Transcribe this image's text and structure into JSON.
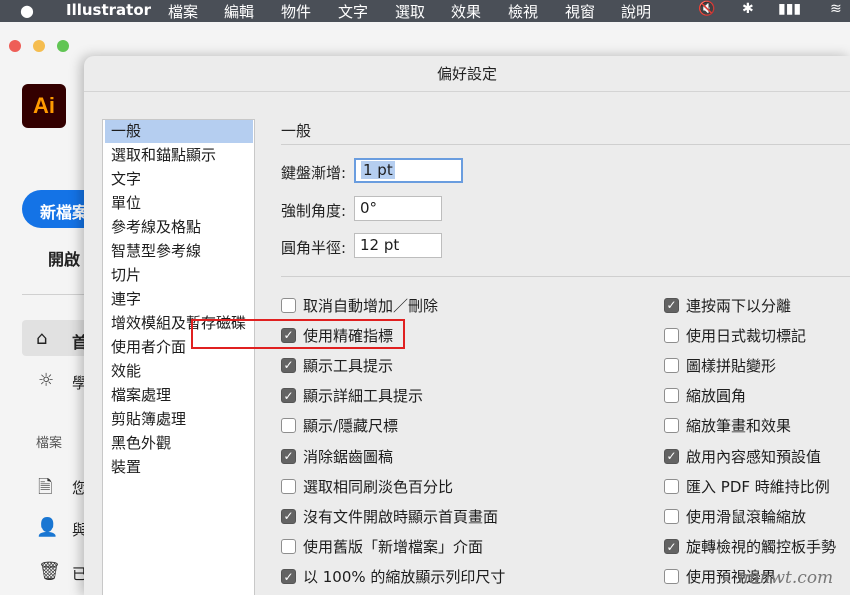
{
  "menubar": {
    "apple_icon": "",
    "app_name": "Illustrator",
    "items": [
      "檔案",
      "編輯",
      "物件",
      "文字",
      "選取",
      "效果",
      "檢視",
      "視窗",
      "說明"
    ],
    "status_icons": [
      "mute-icon",
      "bluetooth-icon",
      "battery-icon",
      "wifi-icon"
    ]
  },
  "background_app": {
    "logo_text": "Ai",
    "new_button": "新檔案",
    "open_button": "開啟",
    "nav_home": "首",
    "nav_learn": "學",
    "files_header": "檔案",
    "nav_files": "您",
    "nav_shared": "與",
    "nav_deleted": "已"
  },
  "dialog": {
    "title": "偏好設定",
    "categories": [
      "一般",
      "選取和錨點顯示",
      "文字",
      "單位",
      "參考線及格點",
      "智慧型參考線",
      "切片",
      "連字",
      "增效模組及暫存磁碟",
      "使用者介面",
      "效能",
      "檔案處理",
      "剪貼簿處理",
      "黑色外觀",
      "裝置"
    ],
    "selected_category": "一般",
    "section_title": "一般",
    "fields": {
      "keyboard_increment": {
        "label": "鍵盤漸增:",
        "value": "1 pt"
      },
      "constrain_angle": {
        "label": "強制角度:",
        "value": "0°"
      },
      "corner_radius": {
        "label": "圓角半徑:",
        "value": "12 pt"
      }
    },
    "left_options": [
      {
        "label": "取消自動增加／刪除",
        "checked": false
      },
      {
        "label": "使用精確指標",
        "checked": true
      },
      {
        "label": "顯示工具提示",
        "checked": true
      },
      {
        "label": "顯示詳細工具提示",
        "checked": true
      },
      {
        "label": "顯示/隱藏尺標",
        "checked": false
      },
      {
        "label": "消除鋸齒圖稿",
        "checked": true
      },
      {
        "label": "選取相同刷淡色百分比",
        "checked": false
      },
      {
        "label": "沒有文件開啟時顯示首頁畫面",
        "checked": true
      },
      {
        "label": "使用舊版「新增檔案」介面",
        "checked": false
      },
      {
        "label": "以 100% 的縮放顯示列印尺寸",
        "checked": true
      }
    ],
    "right_options": [
      {
        "label": "連按兩下以分離",
        "checked": true
      },
      {
        "label": "使用日式裁切標記",
        "checked": false
      },
      {
        "label": "圖樣拼貼變形",
        "checked": false
      },
      {
        "label": "縮放圓角",
        "checked": false
      },
      {
        "label": "縮放筆畫和效果",
        "checked": false
      },
      {
        "label": "啟用內容感知預設值",
        "checked": true
      },
      {
        "label": "匯入 PDF 時維持比例",
        "checked": false
      },
      {
        "label": "使用滑鼠滾輪縮放",
        "checked": false
      },
      {
        "label": "旋轉檢視的觸控板手勢",
        "checked": true
      },
      {
        "label": "使用預視邊界",
        "checked": false
      }
    ],
    "highlight_color": "#e02020"
  },
  "watermark": "minwt.com"
}
